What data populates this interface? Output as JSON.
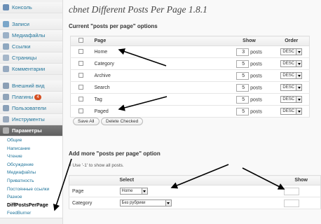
{
  "sidebar": {
    "top": [
      {
        "label": "Консоль",
        "color": "#6b8fb6"
      }
    ],
    "group1": [
      {
        "label": "Записи",
        "color": "#7aa6c9"
      },
      {
        "label": "Медиафайлы",
        "color": "#9bb1c7"
      },
      {
        "label": "Ссылки",
        "color": "#8fa8c0"
      },
      {
        "label": "Страницы",
        "color": "#a6b7c9"
      },
      {
        "label": "Комментарии",
        "color": "#97aac0"
      }
    ],
    "group2": [
      {
        "label": "Внешний вид",
        "color": "#8b9fb5"
      },
      {
        "label": "Плагины",
        "color": "#90a4b9",
        "badge": "4"
      },
      {
        "label": "Пользователи",
        "color": "#8aa0b7"
      },
      {
        "label": "Инструменты",
        "color": "#9aaabd"
      },
      {
        "label": "Параметры",
        "color": "#b0b0b0"
      }
    ],
    "submenu": [
      "Общие",
      "Написание",
      "Чтение",
      "Обсуждение",
      "Медиафайлы",
      "Приватность",
      "Постоянные ссылки",
      "Разное",
      "DiffPostsPerPage",
      "FeedBurner"
    ],
    "current_sub": "DiffPostsPerPage"
  },
  "title": "cbnet Different Posts Per Page 1.8.1",
  "section1": {
    "heading": "Current \"posts per page\" options",
    "headers": {
      "page": "Page",
      "show": "Show",
      "order": "Order"
    },
    "rows": [
      {
        "page": "Home",
        "show": "3",
        "unit": "posts",
        "order": "DESC"
      },
      {
        "page": "Category",
        "show": "5",
        "unit": "posts",
        "order": "DESC"
      },
      {
        "page": "Archive",
        "show": "5",
        "unit": "posts",
        "order": "DESC"
      },
      {
        "page": "Search",
        "show": "5",
        "unit": "posts",
        "order": "DESC"
      },
      {
        "page": "Tag",
        "show": "5",
        "unit": "posts",
        "order": "DESC"
      },
      {
        "page": "Paged",
        "show": "5",
        "unit": "posts",
        "order": "DESC"
      }
    ],
    "save_all": "Save All",
    "delete_checked": "Delete Checked"
  },
  "section2": {
    "heading": "Add more \"posts per page\" option",
    "hint": "# Use '-1' to show all posts.",
    "headers": {
      "select": "Select",
      "show": "Show"
    },
    "rows": [
      {
        "label": "Page",
        "value": "Home"
      },
      {
        "label": "Category",
        "value": "Без рубрики"
      }
    ]
  }
}
